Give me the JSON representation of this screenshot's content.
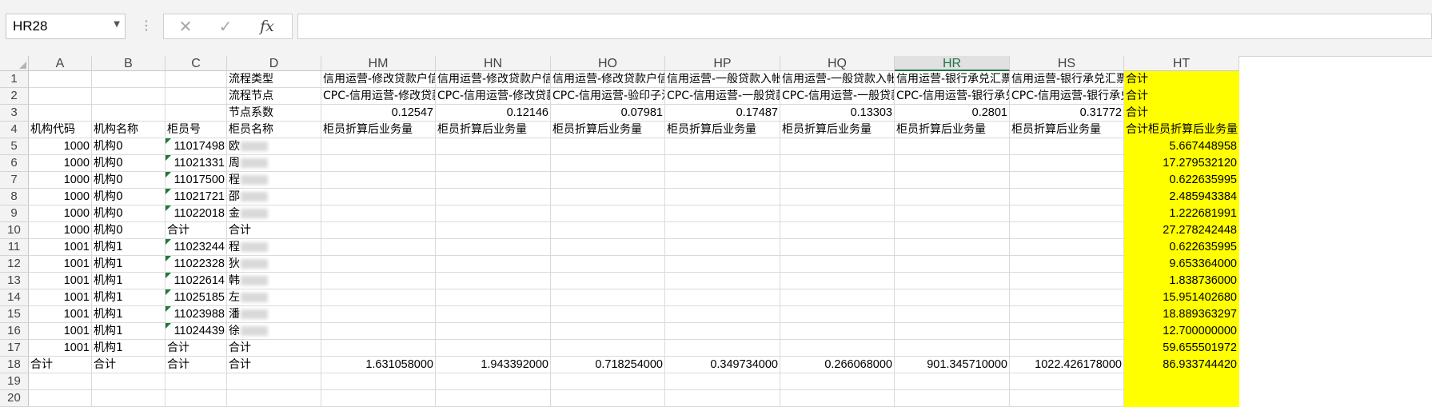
{
  "namebox": {
    "value": "HR28"
  },
  "formula_bar": {
    "cancel_icon": "✕",
    "enter_icon": "✓",
    "fx_label": "fx",
    "value": ""
  },
  "columns": [
    {
      "label": "A",
      "w": 79
    },
    {
      "label": "B",
      "w": 92
    },
    {
      "label": "C",
      "w": 77
    },
    {
      "label": "D",
      "w": 118
    },
    {
      "label": "HM",
      "w": 143
    },
    {
      "label": "HN",
      "w": 144
    },
    {
      "label": "HO",
      "w": 143
    },
    {
      "label": "HP",
      "w": 144
    },
    {
      "label": "HQ",
      "w": 143
    },
    {
      "label": "HR",
      "w": 144
    },
    {
      "label": "HS",
      "w": 143
    },
    {
      "label": "HT",
      "w": 144
    }
  ],
  "active_column": "HR",
  "rows": [
    {
      "n": "1",
      "cells": [
        "",
        "",
        "",
        "流程类型",
        "信用运营-修改贷款户信息",
        "信用运营-修改贷款户信息",
        "信用运营-修改贷款户信息",
        "信用运营-一般贷款入帐",
        "信用运营-一般贷款入帐",
        "信用运营-银行承兑汇票",
        "信用运营-银行承兑汇票",
        "合计"
      ]
    },
    {
      "n": "2",
      "cells": [
        "",
        "",
        "",
        "流程节点",
        "CPC-信用运营-修改贷款",
        "CPC-信用运营-修改贷款",
        "CPC-信用运营-验印子流程",
        "CPC-信用运营-一般贷款",
        "CPC-信用运营-一般贷款",
        "CPC-信用运营-银行承兑",
        "CPC-信用运营-银行承兑",
        "合计"
      ]
    },
    {
      "n": "3",
      "cells": [
        "",
        "",
        "",
        "节点系数",
        "0.12547",
        "0.12146",
        "0.07981",
        "0.17487",
        "0.13303",
        "0.2801",
        "0.31772",
        "合计"
      ]
    },
    {
      "n": "4",
      "cells": [
        "机构代码",
        "机构名称",
        "柜员号",
        "柜员名称",
        "柜员折算后业务量",
        "柜员折算后业务量",
        "柜员折算后业务量",
        "柜员折算后业务量",
        "柜员折算后业务量",
        "柜员折算后业务量",
        "柜员折算后业务量",
        "合计柜员折算后业务量"
      ]
    },
    {
      "n": "5",
      "cells": [
        "1000",
        "机构0",
        "11017498",
        "欧",
        "",
        "",
        "",
        "",
        "",
        "",
        "",
        "5.667448958"
      ],
      "tri": true,
      "blur": true
    },
    {
      "n": "6",
      "cells": [
        "1000",
        "机构0",
        "11021331",
        "周",
        "",
        "",
        "",
        "",
        "",
        "",
        "",
        "17.279532120"
      ],
      "tri": true,
      "blur": true
    },
    {
      "n": "7",
      "cells": [
        "1000",
        "机构0",
        "11017500",
        "程",
        "",
        "",
        "",
        "",
        "",
        "",
        "",
        "0.622635995"
      ],
      "tri": true,
      "blur": true
    },
    {
      "n": "8",
      "cells": [
        "1000",
        "机构0",
        "11021721",
        "邵",
        "",
        "",
        "",
        "",
        "",
        "",
        "",
        "2.485943384"
      ],
      "tri": true,
      "blur": true
    },
    {
      "n": "9",
      "cells": [
        "1000",
        "机构0",
        "11022018",
        "金",
        "",
        "",
        "",
        "",
        "",
        "",
        "",
        "1.222681991"
      ],
      "tri": true,
      "blur": true
    },
    {
      "n": "10",
      "cells": [
        "1000",
        "机构0",
        "合计",
        "合计",
        "",
        "",
        "",
        "",
        "",
        "",
        "",
        "27.278242448"
      ]
    },
    {
      "n": "11",
      "cells": [
        "1001",
        "机构1",
        "11023244",
        "程",
        "",
        "",
        "",
        "",
        "",
        "",
        "",
        "0.622635995"
      ],
      "tri": true,
      "blur": true
    },
    {
      "n": "12",
      "cells": [
        "1001",
        "机构1",
        "11022328",
        "狄",
        "",
        "",
        "",
        "",
        "",
        "",
        "",
        "9.653364000"
      ],
      "tri": true,
      "blur": true
    },
    {
      "n": "13",
      "cells": [
        "1001",
        "机构1",
        "11022614",
        "韩",
        "",
        "",
        "",
        "",
        "",
        "",
        "",
        "1.838736000"
      ],
      "tri": true,
      "blur": true
    },
    {
      "n": "14",
      "cells": [
        "1001",
        "机构1",
        "11025185",
        "左",
        "",
        "",
        "",
        "",
        "",
        "",
        "",
        "15.951402680"
      ],
      "tri": true,
      "blur": true
    },
    {
      "n": "15",
      "cells": [
        "1001",
        "机构1",
        "11023988",
        "潘",
        "",
        "",
        "",
        "",
        "",
        "",
        "",
        "18.889363297"
      ],
      "tri": true,
      "blur": true
    },
    {
      "n": "16",
      "cells": [
        "1001",
        "机构1",
        "11024439",
        "徐",
        "",
        "",
        "",
        "",
        "",
        "",
        "",
        "12.700000000"
      ],
      "tri": true,
      "blur": true
    },
    {
      "n": "17",
      "cells": [
        "1001",
        "机构1",
        "合计",
        "合计",
        "",
        "",
        "",
        "",
        "",
        "",
        "",
        "59.655501972"
      ]
    },
    {
      "n": "18",
      "cells": [
        "合计",
        "合计",
        "合计",
        "合计",
        "1.631058000",
        "1.943392000",
        "0.718254000",
        "0.349734000",
        "0.266068000",
        "901.345710000",
        "1022.426178000",
        "86.933744420"
      ]
    },
    {
      "n": "19",
      "cells": [
        "",
        "",
        "",
        "",
        "",
        "",
        "",
        "",
        "",
        "",
        "",
        ""
      ]
    },
    {
      "n": "20",
      "cells": [
        "",
        "",
        "",
        "",
        "",
        "",
        "",
        "",
        "",
        "",
        "",
        ""
      ]
    }
  ]
}
